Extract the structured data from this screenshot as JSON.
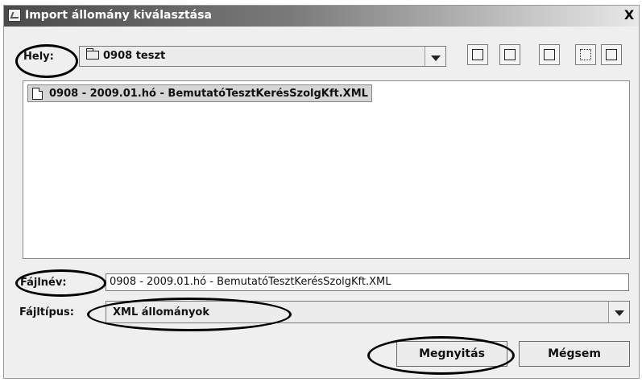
{
  "window": {
    "title": "Import állomány kiválasztása",
    "close_label": "X",
    "icons": [
      "java-icon",
      "close-icon"
    ]
  },
  "location": {
    "label": "Hely:",
    "value": "0908 teszt",
    "icons": [
      "folder-icon",
      "chevron-down-icon"
    ]
  },
  "toolbar": {
    "buttons": [
      "up-one-level-icon",
      "home-icon",
      "new-folder-icon",
      "list-view-icon",
      "details-view-icon"
    ]
  },
  "file_list": {
    "items": [
      {
        "name": "0908 - 2009.01.hó - BemutatóTesztKerésSzolgKft.XML",
        "selected": true,
        "icon": "file-icon"
      }
    ]
  },
  "filename": {
    "label": "Fájlnév:",
    "value": "0908 - 2009.01.hó - BemutatóTesztKerésSzolgKft.XML"
  },
  "filetype": {
    "label": "Fájltípus:",
    "value": "XML állományok"
  },
  "buttons": {
    "open_label": "Megnyitás",
    "cancel_label": "Mégsem"
  }
}
